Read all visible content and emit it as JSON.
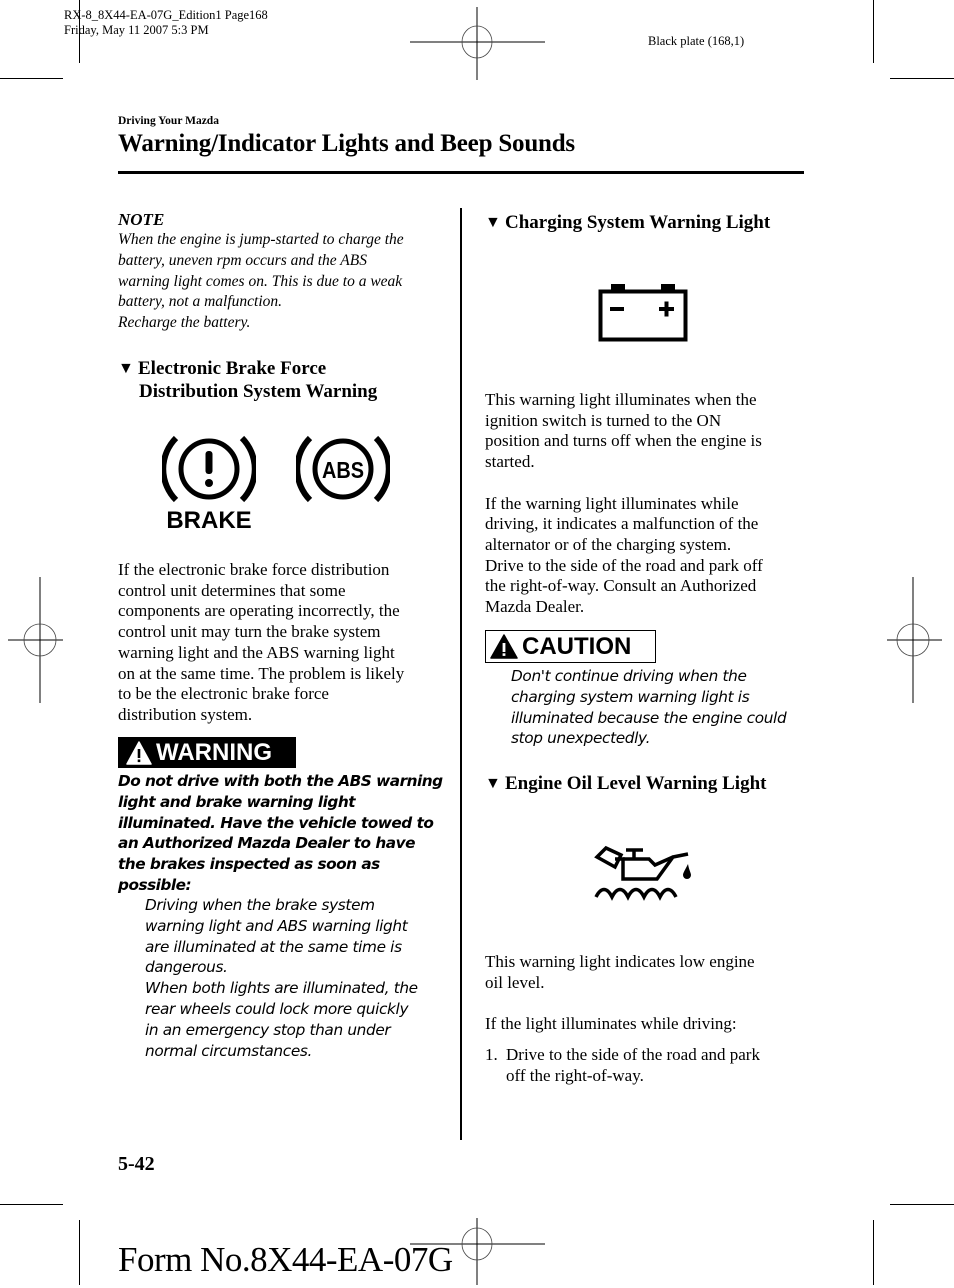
{
  "print_meta": {
    "file_line": "RX-8_8X44-EA-07G_Edition1 Page168",
    "date_line": "Friday, May 11 2007 5:3 PM",
    "plate": "Black plate (168,1)"
  },
  "header": {
    "section": "Driving Your Mazda",
    "title": "Warning/Indicator Lights and Beep Sounds"
  },
  "left_column": {
    "note": {
      "title": "NOTE",
      "lines": [
        "When the engine is jump-started to charge the",
        "battery, uneven rpm occurs and the ABS",
        "warning light comes on. This is due to a weak",
        "battery, not a malfunction.",
        "Recharge the battery."
      ]
    },
    "ebd_section": {
      "marker": "▼",
      "heading_lines": [
        "Electronic Brake Force",
        "Distribution System Warning"
      ],
      "icons": [
        {
          "name": "brake-warning-icon",
          "label": "BRAKE"
        },
        {
          "name": "abs-warning-icon",
          "label": "ABS"
        }
      ],
      "body_lines": [
        "If the electronic brake force distribution",
        "control unit determines that some",
        "components are operating incorrectly, the",
        "control unit may turn the brake system",
        "warning light and the ABS warning light",
        "on at the same time. The problem is likely",
        "to be the electronic brake force",
        "distribution system."
      ],
      "warning": {
        "label": "WARNING",
        "bold_lines": [
          "Do not drive with both the ABS warning",
          "light and brake warning light",
          "illuminated. Have the vehicle towed to",
          "an Authorized Mazda Dealer to have",
          "the brakes inspected as soon as",
          "possible:"
        ],
        "detail_lines": [
          "Driving when the brake system",
          "warning light and ABS warning light",
          "are illuminated at the same time is",
          "dangerous.",
          "When both lights are illuminated, the",
          "rear wheels could lock more quickly",
          "in an emergency stop than under",
          "normal circumstances."
        ]
      }
    }
  },
  "right_column": {
    "charging_section": {
      "marker": "▼",
      "heading": "Charging System Warning Light",
      "icon": "battery-icon",
      "para1_lines": [
        "This warning light illuminates when the",
        "ignition switch is turned to the ON",
        "position and turns off when the engine is",
        "started."
      ],
      "para2_lines": [
        "If the warning light illuminates while",
        "driving, it indicates a malfunction of the",
        "alternator or of the charging system.",
        "Drive to the side of the road and park off",
        "the right-of-way. Consult an Authorized",
        "Mazda Dealer."
      ],
      "caution": {
        "label": "CAUTION",
        "lines": [
          "Don't continue driving when the",
          "charging system warning light is",
          "illuminated because the engine could",
          "stop unexpectedly."
        ]
      }
    },
    "oil_section": {
      "marker": "▼",
      "heading": "Engine Oil Level Warning Light",
      "icon": "oil-can-icon",
      "para1_lines": [
        "This warning light indicates low engine",
        "oil level."
      ],
      "para2": "If the light illuminates while driving:",
      "steps": [
        {
          "num": "1.",
          "lines": [
            "Drive to the side of the road and park",
            "off the right-of-way."
          ]
        }
      ]
    }
  },
  "footer": {
    "page_number": "5-42",
    "form_number": "Form No.8X44-EA-07G"
  }
}
